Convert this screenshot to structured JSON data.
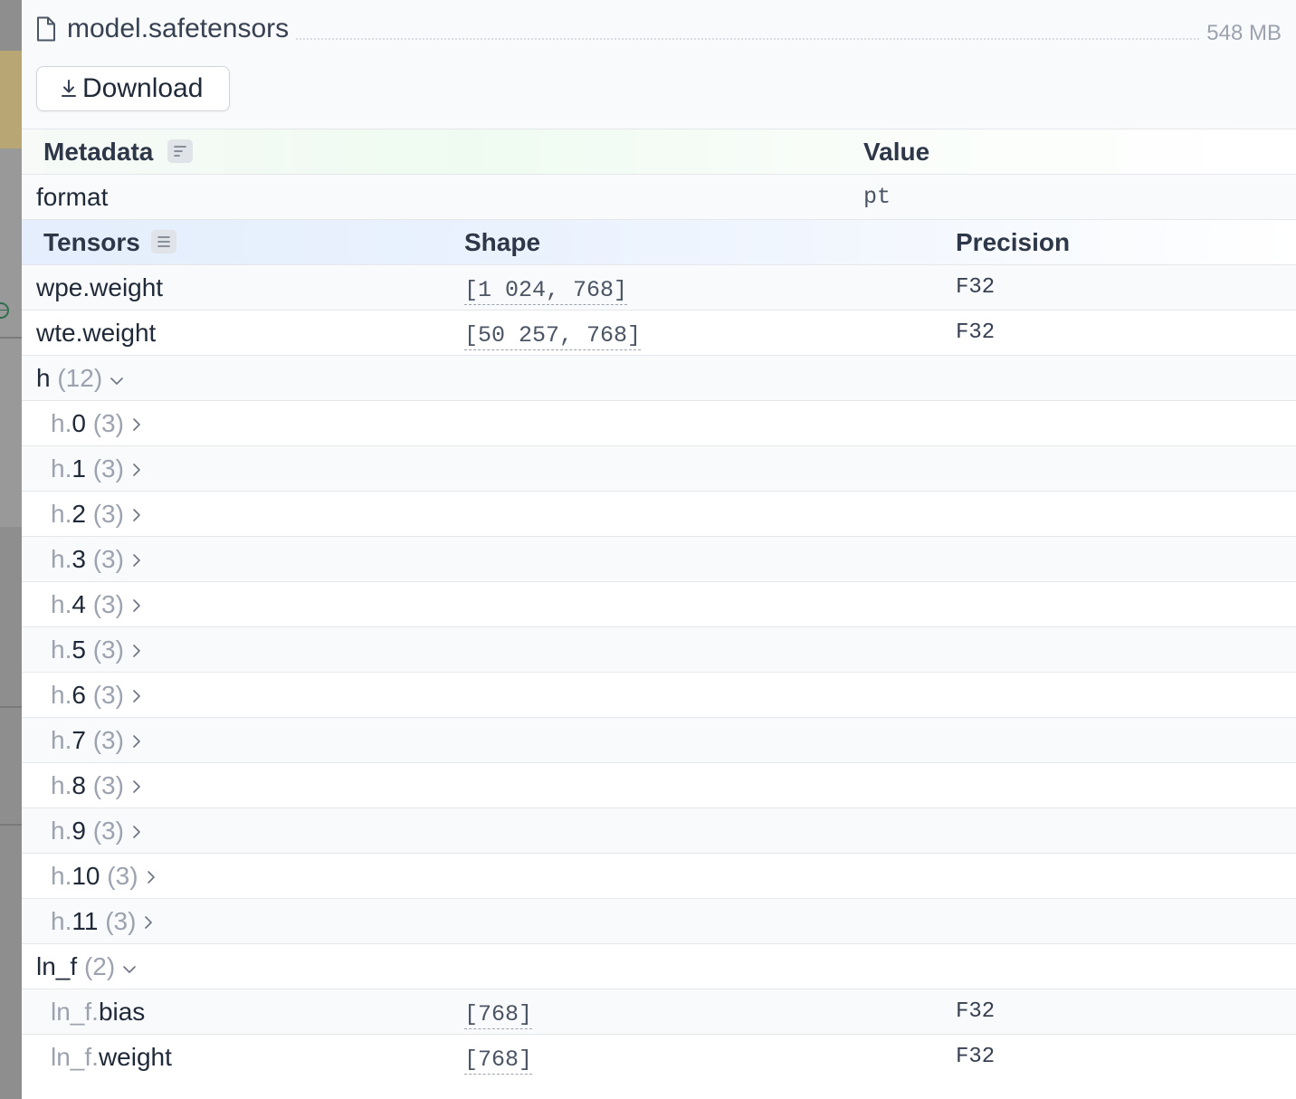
{
  "file": {
    "name": "model.safetensors",
    "size": "548 MB",
    "download_label": "Download"
  },
  "metadata": {
    "header": {
      "col1": "Metadata",
      "col2": "Value"
    },
    "rows": [
      {
        "key": "format",
        "value": "pt"
      }
    ]
  },
  "tensors": {
    "header": {
      "col1": "Tensors",
      "col2": "Shape",
      "col3": "Precision"
    },
    "top_rows": [
      {
        "name": "wpe.weight",
        "shape": "[1 024, 768]",
        "precision": "F32"
      },
      {
        "name": "wte.weight",
        "shape": "[50 257, 768]",
        "precision": "F32"
      }
    ],
    "group_h": {
      "name": "h",
      "count": "(12)",
      "children": [
        {
          "prefix": "h.",
          "name": "0",
          "count": "(3)"
        },
        {
          "prefix": "h.",
          "name": "1",
          "count": "(3)"
        },
        {
          "prefix": "h.",
          "name": "2",
          "count": "(3)"
        },
        {
          "prefix": "h.",
          "name": "3",
          "count": "(3)"
        },
        {
          "prefix": "h.",
          "name": "4",
          "count": "(3)"
        },
        {
          "prefix": "h.",
          "name": "5",
          "count": "(3)"
        },
        {
          "prefix": "h.",
          "name": "6",
          "count": "(3)"
        },
        {
          "prefix": "h.",
          "name": "7",
          "count": "(3)"
        },
        {
          "prefix": "h.",
          "name": "8",
          "count": "(3)"
        },
        {
          "prefix": "h.",
          "name": "9",
          "count": "(3)"
        },
        {
          "prefix": "h.",
          "name": "10",
          "count": "(3)"
        },
        {
          "prefix": "h.",
          "name": "11",
          "count": "(3)"
        }
      ]
    },
    "group_ln_f": {
      "name": "ln_f",
      "count": "(2)",
      "children": [
        {
          "prefix": "ln_f.",
          "name": "bias",
          "shape": "[768]",
          "precision": "F32"
        },
        {
          "prefix": "ln_f.",
          "name": "weight",
          "shape": "[768]",
          "precision": "F32"
        }
      ]
    }
  },
  "icons": {
    "file": "file-icon",
    "download": "download-icon",
    "metadata_sort": "sort-lines-icon",
    "tensors_menu": "menu-lines-icon",
    "expanded": "chevron-down-icon",
    "collapsed": "chevron-right-icon"
  }
}
